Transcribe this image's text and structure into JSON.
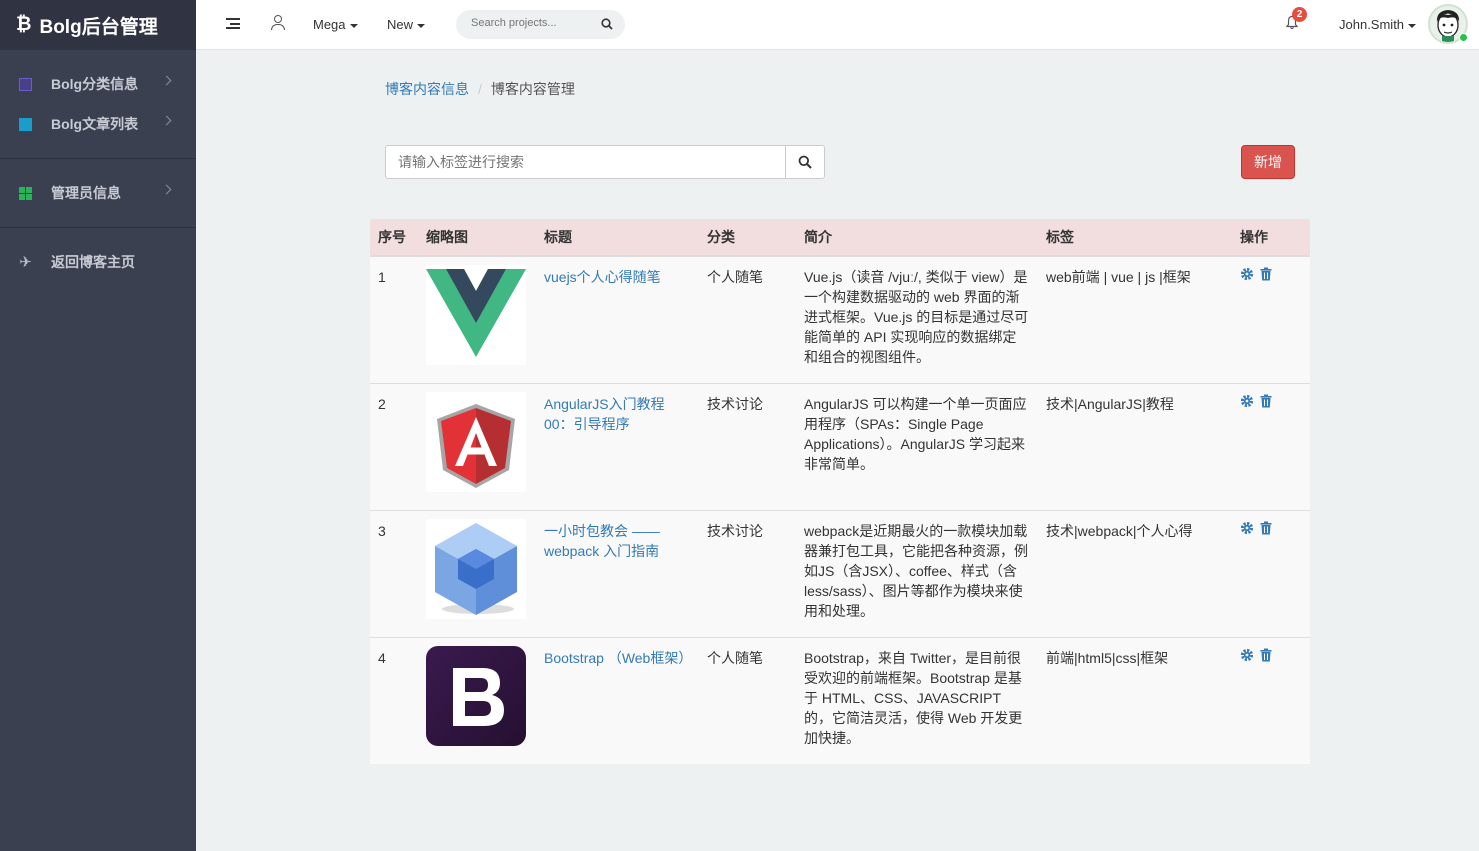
{
  "sidebar": {
    "brand": "Bolg后台管理",
    "items": [
      {
        "label": "Bolg分类信息",
        "icon": "list-icon"
      },
      {
        "label": "Bolg文章列表",
        "icon": "book-icon"
      },
      {
        "label": "管理员信息",
        "icon": "grid-icon"
      },
      {
        "label": "返回博客主页",
        "icon": "plane-icon"
      }
    ]
  },
  "header": {
    "mega_label": "Mega",
    "new_label": "New",
    "search_placeholder": "Search projects...",
    "notification_count": "2",
    "username": "John.Smith"
  },
  "breadcrumb": {
    "parent": "博客内容信息",
    "separator": "/",
    "current": "博客内容管理"
  },
  "toolbar": {
    "tag_search_placeholder": "请输入标签进行搜索",
    "add_label": "新增"
  },
  "table": {
    "headers": [
      "序号",
      "缩略图",
      "标题",
      "分类",
      "简介",
      "标签",
      "操作"
    ],
    "rows": [
      {
        "index": "1",
        "thumbnail": "vue-logo",
        "title": "vuejs个人心得随笔",
        "category": "个人随笔",
        "intro": "Vue.js（读音 /vjuː/, 类似于 view）是一个构建数据驱动的 web 界面的渐进式框架。Vue.js 的目标是通过尽可能简单的 API 实现响应的数据绑定和组合的视图组件。",
        "tags": "web前端 | vue | js |框架"
      },
      {
        "index": "2",
        "thumbnail": "angular-logo",
        "title": "AngularJS入门教程00：引导程序",
        "category": "技术讨论",
        "intro": "AngularJS 可以构建一个单一页面应用程序（SPAs：Single Page Applications）。AngularJS 学习起来非常简单。",
        "tags": "技术|AngularJS|教程"
      },
      {
        "index": "3",
        "thumbnail": "webpack-logo",
        "title": "一小时包教会 —— webpack 入门指南",
        "category": "技术讨论",
        "intro": "webpack是近期最火的一款模块加载器兼打包工具，它能把各种资源，例如JS（含JSX）、coffee、样式（含less/sass）、图片等都作为模块来使用和处理。",
        "tags": "技术|webpack|个人心得"
      },
      {
        "index": "4",
        "thumbnail": "bootstrap-logo",
        "title": "Bootstrap （Web框架）",
        "category": "个人随笔",
        "intro": "Bootstrap，来自 Twitter，是目前很受欢迎的前端框架。Bootstrap 是基于 HTML、CSS、JAVASCRIPT 的，它简洁灵活，使得 Web 开发更加快捷。",
        "tags": "前端|html5|css|框架"
      }
    ]
  },
  "colors": {
    "sidebar_bg": "#3b4051",
    "brand_bg": "#2f3342",
    "link": "#337ab7",
    "danger": "#d9534f",
    "table_header_bg": "#f2dede",
    "badge": "#e84c3d"
  }
}
